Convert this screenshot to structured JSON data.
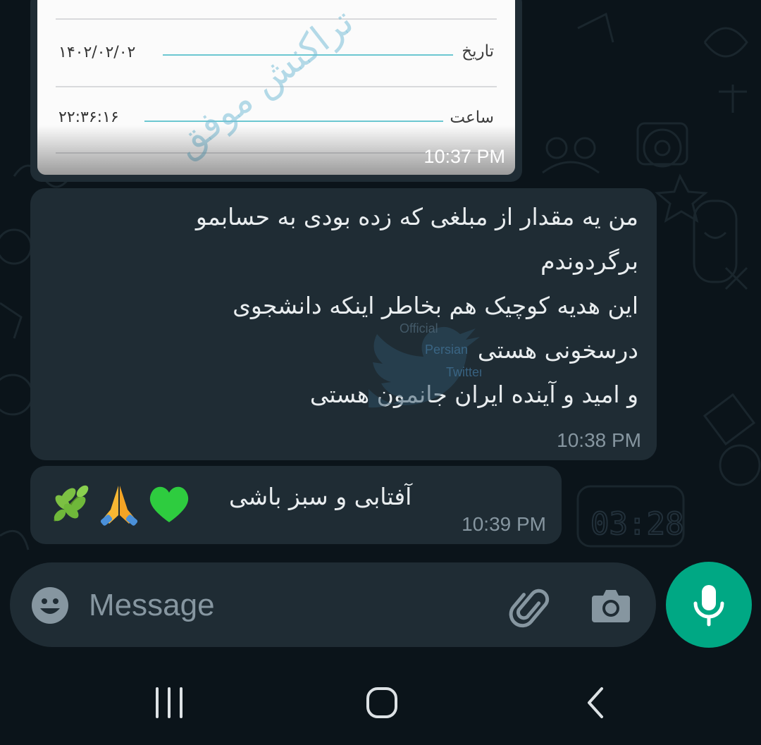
{
  "image_message": {
    "date_label": "تاریخ",
    "date_value": "۱۴۰۲/۰۲/۰۲",
    "time_label": "ساعت",
    "time_value": "۲۲:۳۶:۱۶",
    "watermark": "تراکنش موفق",
    "timestamp": "10:37 PM"
  },
  "message_1": {
    "lines": [
      "من یه مقدار از مبلغی که زده بودی به حسابمو",
      "برگردوندم",
      "این هدیه کوچیک هم بخاطر اینکه دانشجوی",
      "درسخونی هستی",
      "و امید و آینده ایران جانمون هستی"
    ],
    "timestamp": "10:38 PM",
    "overlay_watermark": [
      "Official",
      "Persian",
      "Twitter"
    ]
  },
  "message_2": {
    "text": "آفتابی و سبز باشی",
    "emojis": [
      "green-heart",
      "folded-hands",
      "herb"
    ],
    "timestamp": "10:39 PM"
  },
  "composer": {
    "placeholder": "Message",
    "icons": [
      "emoji-icon",
      "attach-icon",
      "camera-icon",
      "mic-icon"
    ]
  },
  "colors": {
    "background": "#0b141a",
    "bubble": "#1f2c34",
    "accent": "#00a884",
    "timestamp": "#8696a0",
    "text": "#e9edef"
  },
  "nav_bar": {
    "buttons": [
      "recents",
      "home",
      "back"
    ]
  }
}
